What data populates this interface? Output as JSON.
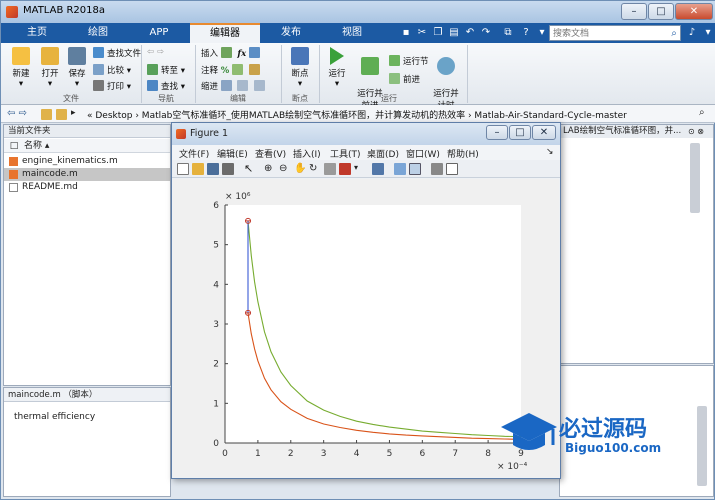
{
  "window": {
    "title": "MATLAB R2018a"
  },
  "tabs": [
    "主页",
    "绘图",
    "APP",
    "编辑器",
    "发布",
    "视图"
  ],
  "active_tab": "编辑器",
  "search": {
    "placeholder": "搜索文档"
  },
  "ribbon": {
    "file": {
      "new": "新建",
      "open": "打开",
      "save": "保存",
      "find_files": "查找文件",
      "compare": "比较",
      "print": "打印",
      "group": "文件"
    },
    "nav": {
      "goto": "转至",
      "find": "查找",
      "group": "导航"
    },
    "edit": {
      "insert": "插入",
      "comment": "注释",
      "indent": "缩进",
      "group": "编辑"
    },
    "breakpoints": {
      "label": "断点",
      "group": "断点"
    },
    "run": {
      "run": "运行",
      "run_advance": "运行并\n前进",
      "run_section": "运行节",
      "advance": "前进",
      "run_time": "运行并\n计时",
      "group": "运行"
    }
  },
  "address": {
    "path": "« Desktop › Matlab空气标准循环_使用MATLAB绘制空气标准循环图，并计算发动机的热效率 › Matlab-Air-Standard-Cycle-master"
  },
  "current_folder": {
    "header": "当前文件夹",
    "column": "名称",
    "files": [
      {
        "name": "engine_kinematics.m",
        "selected": false
      },
      {
        "name": "maincode.m",
        "selected": true
      },
      {
        "name": "README.md",
        "selected": false
      }
    ]
  },
  "details": {
    "header": "maincode.m （脚本）",
    "content": "thermal efficiency"
  },
  "editor": {
    "tab_text": "LAB绘制空气标准循环图，并..."
  },
  "figure": {
    "title": "Figure 1",
    "menu": [
      "文件(F)",
      "编辑(E)",
      "查看(V)",
      "插入(I)",
      "工具(T)",
      "桌面(D)",
      "窗口(W)",
      "帮助(H)"
    ]
  },
  "chart_data": {
    "type": "line",
    "xlim": [
      0,
      9
    ],
    "ylim": [
      0,
      6
    ],
    "x_ticks": [
      "0",
      "1",
      "2",
      "3",
      "4",
      "5",
      "6",
      "7",
      "8",
      "9"
    ],
    "y_ticks": [
      "0",
      "1",
      "2",
      "3",
      "4",
      "5",
      "6"
    ],
    "x_multiplier": "× 10⁻⁴",
    "y_multiplier": "× 10⁶",
    "series": [
      {
        "color": "#77ac30",
        "x": [
          0.7,
          0.8,
          0.9,
          1.0,
          1.2,
          1.4,
          1.7,
          2.0,
          2.5,
          3.0,
          3.5,
          4.0,
          4.5,
          5.0,
          5.5,
          6.0,
          6.5,
          7.0,
          7.5,
          8.0,
          8.5,
          9.0
        ],
        "y": [
          5.6,
          4.72,
          4.06,
          3.56,
          2.8,
          2.3,
          1.79,
          1.45,
          1.06,
          0.83,
          0.67,
          0.55,
          0.47,
          0.4,
          0.35,
          0.3,
          0.27,
          0.24,
          0.21,
          0.19,
          0.17,
          0.16
        ]
      },
      {
        "color": "#d95319",
        "x": [
          0.7,
          0.8,
          0.9,
          1.0,
          1.2,
          1.4,
          1.7,
          2.0,
          2.5,
          3.0,
          3.5,
          4.0,
          4.5,
          5.0,
          5.5,
          6.0,
          6.5,
          7.0,
          7.5,
          8.0,
          8.5,
          9.0
        ],
        "y": [
          3.28,
          2.75,
          2.37,
          2.07,
          1.63,
          1.34,
          1.04,
          0.85,
          0.62,
          0.48,
          0.39,
          0.32,
          0.27,
          0.23,
          0.2,
          0.18,
          0.16,
          0.14,
          0.12,
          0.11,
          0.1,
          0.09
        ]
      },
      {
        "color": "#3b5bd6",
        "x": [
          0.7,
          0.7
        ],
        "y": [
          3.28,
          5.6
        ]
      }
    ],
    "markers": [
      {
        "x": 0.7,
        "y": 5.6
      },
      {
        "x": 0.7,
        "y": 3.28
      }
    ]
  },
  "watermark": {
    "text": "必过源码",
    "url": "Biguo100.com"
  }
}
